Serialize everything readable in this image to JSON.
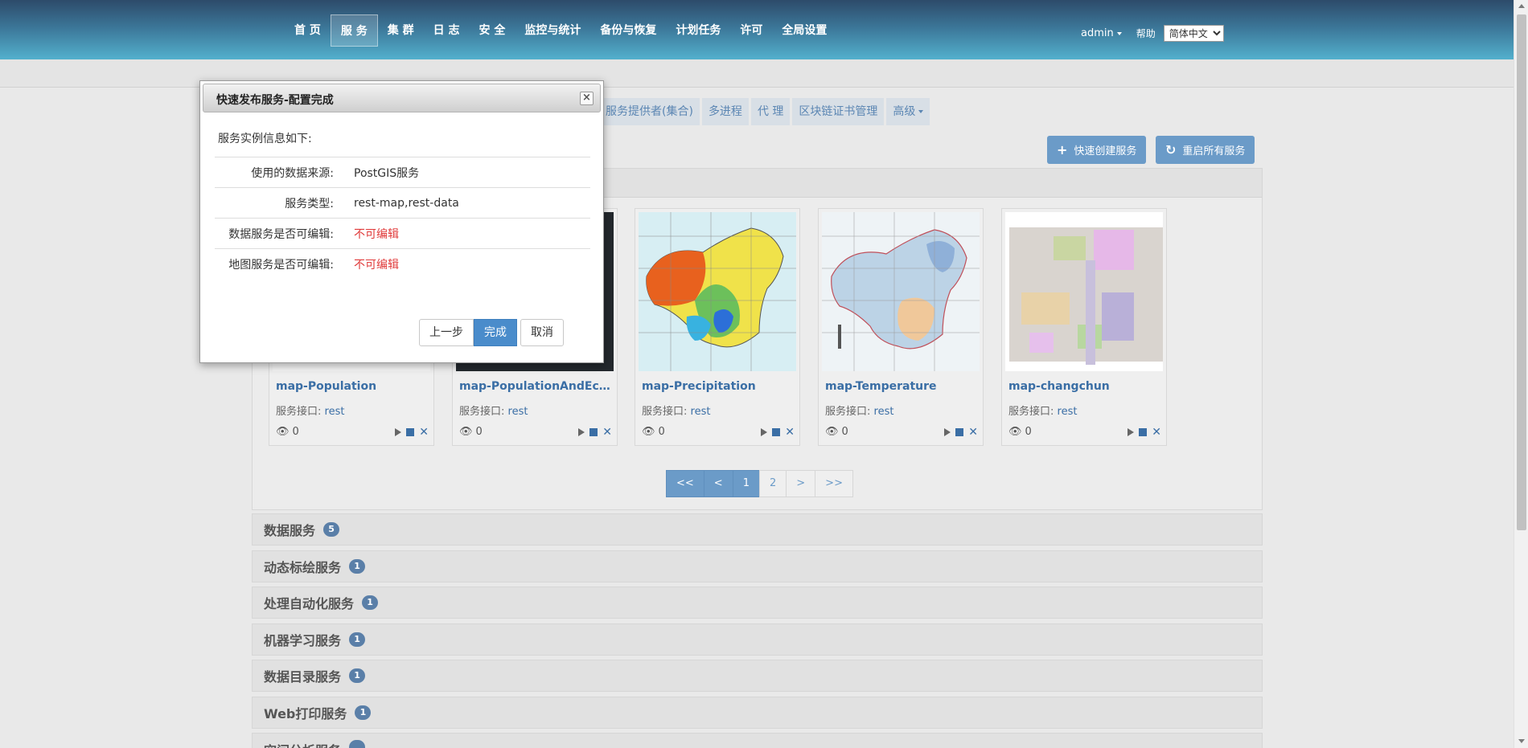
{
  "nav": {
    "items": [
      "首 页",
      "服 务",
      "集 群",
      "日 志",
      "安 全",
      "监控与统计",
      "备份与恢复",
      "计划任务",
      "许可",
      "全局设置"
    ],
    "active_index": 1
  },
  "topright": {
    "user": "admin",
    "help": "帮助",
    "language": "简体中文"
  },
  "subtabs": {
    "items": [
      "服务提供者(集合)",
      "多进程",
      "代 理",
      "区块链证书管理",
      "高级"
    ]
  },
  "actions": {
    "create_label": "快速创建服务",
    "create_icon": "plus-icon",
    "restart_label": "重启所有服务",
    "restart_icon": "refresh-icon"
  },
  "cards": [
    {
      "title": "map-Population",
      "iface_label": "服务接口:",
      "iface_value": "rest",
      "views": "0"
    },
    {
      "title": "map-PopulationAndEcono...",
      "iface_label": "服务接口:",
      "iface_value": "rest",
      "views": "0"
    },
    {
      "title": "map-Precipitation",
      "iface_label": "服务接口:",
      "iface_value": "rest",
      "views": "0"
    },
    {
      "title": "map-Temperature",
      "iface_label": "服务接口:",
      "iface_value": "rest",
      "views": "0"
    },
    {
      "title": "map-changchun",
      "iface_label": "服务接口:",
      "iface_value": "rest",
      "views": "0"
    }
  ],
  "pager": {
    "first": "<<",
    "prev": "<",
    "pages": [
      "1",
      "2"
    ],
    "current": "1",
    "next": ">",
    "last": ">>"
  },
  "sections": [
    {
      "label": "数据服务",
      "count": "5"
    },
    {
      "label": "动态标绘服务",
      "count": "1"
    },
    {
      "label": "处理自动化服务",
      "count": "1"
    },
    {
      "label": "机器学习服务",
      "count": "1"
    },
    {
      "label": "数据目录服务",
      "count": "1"
    },
    {
      "label": "Web打印服务",
      "count": "1"
    },
    {
      "label": "空间分析服务",
      "count": ""
    }
  ],
  "dialog": {
    "title": "快速发布服务-配置完成",
    "intro": "服务实例信息如下:",
    "rows": [
      {
        "key": "使用的数据来源:",
        "value": "PostGIS服务",
        "red": false
      },
      {
        "key": "服务类型:",
        "value": "rest-map,rest-data",
        "red": false
      },
      {
        "key": "数据服务是否可编辑:",
        "value": "不可编辑",
        "red": true
      },
      {
        "key": "地图服务是否可编辑:",
        "value": "不可编辑",
        "red": true
      }
    ],
    "prev_label": "上一步",
    "finish_label": "完成",
    "cancel_label": "取消",
    "close_icon": "close-icon"
  },
  "colors": {
    "accent": "#6b9bc8",
    "primary_button": "#4a8ccb",
    "warning_text": "#e03a3a",
    "link": "#3a6ea5"
  }
}
